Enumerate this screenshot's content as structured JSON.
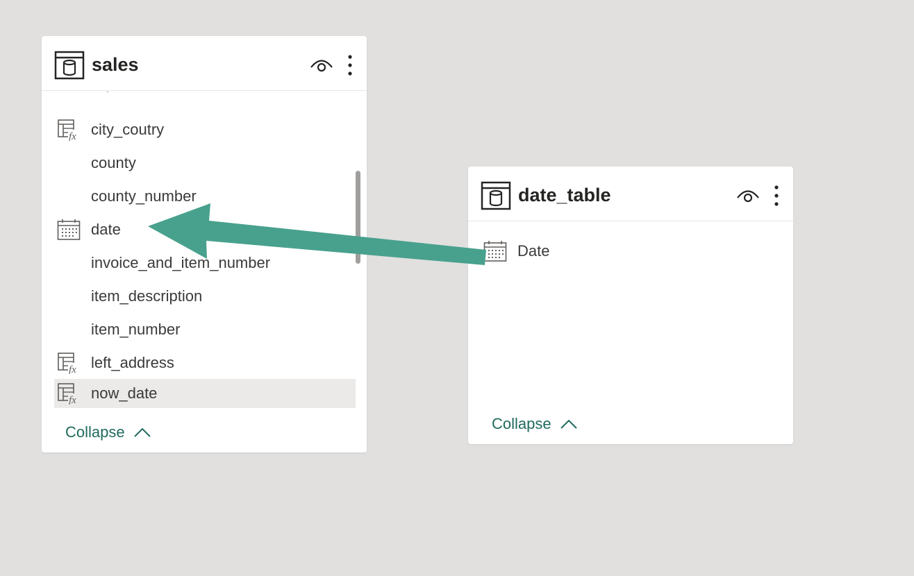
{
  "colors": {
    "canvas": "#e1e0df",
    "card": "#ffffff",
    "accent": "#1f6a5d",
    "arrow": "#48a18d",
    "selected_row": "#ebeae8"
  },
  "sales_table": {
    "title": "sales",
    "icon": "table-database-icon",
    "fields": [
      {
        "label": "city_coutry",
        "icon": "calculated-column-icon"
      },
      {
        "label": "county",
        "icon": ""
      },
      {
        "label": "county_number",
        "icon": ""
      },
      {
        "label": "date",
        "icon": "calendar-icon"
      },
      {
        "label": "invoice_and_item_number",
        "icon": ""
      },
      {
        "label": "item_description",
        "icon": ""
      },
      {
        "label": "item_number",
        "icon": ""
      },
      {
        "label": "left_address",
        "icon": "calculated-column-icon"
      },
      {
        "label": "now_date",
        "icon": "calculated-column-icon",
        "selected": true
      }
    ],
    "collapse_label": "Collapse"
  },
  "date_table": {
    "title": "date_table",
    "icon": "table-database-icon",
    "fields": [
      {
        "label": "Date",
        "icon": "calendar-icon"
      }
    ],
    "collapse_label": "Collapse"
  },
  "relationship": {
    "from": "date_table.Date",
    "to": "sales.date"
  }
}
